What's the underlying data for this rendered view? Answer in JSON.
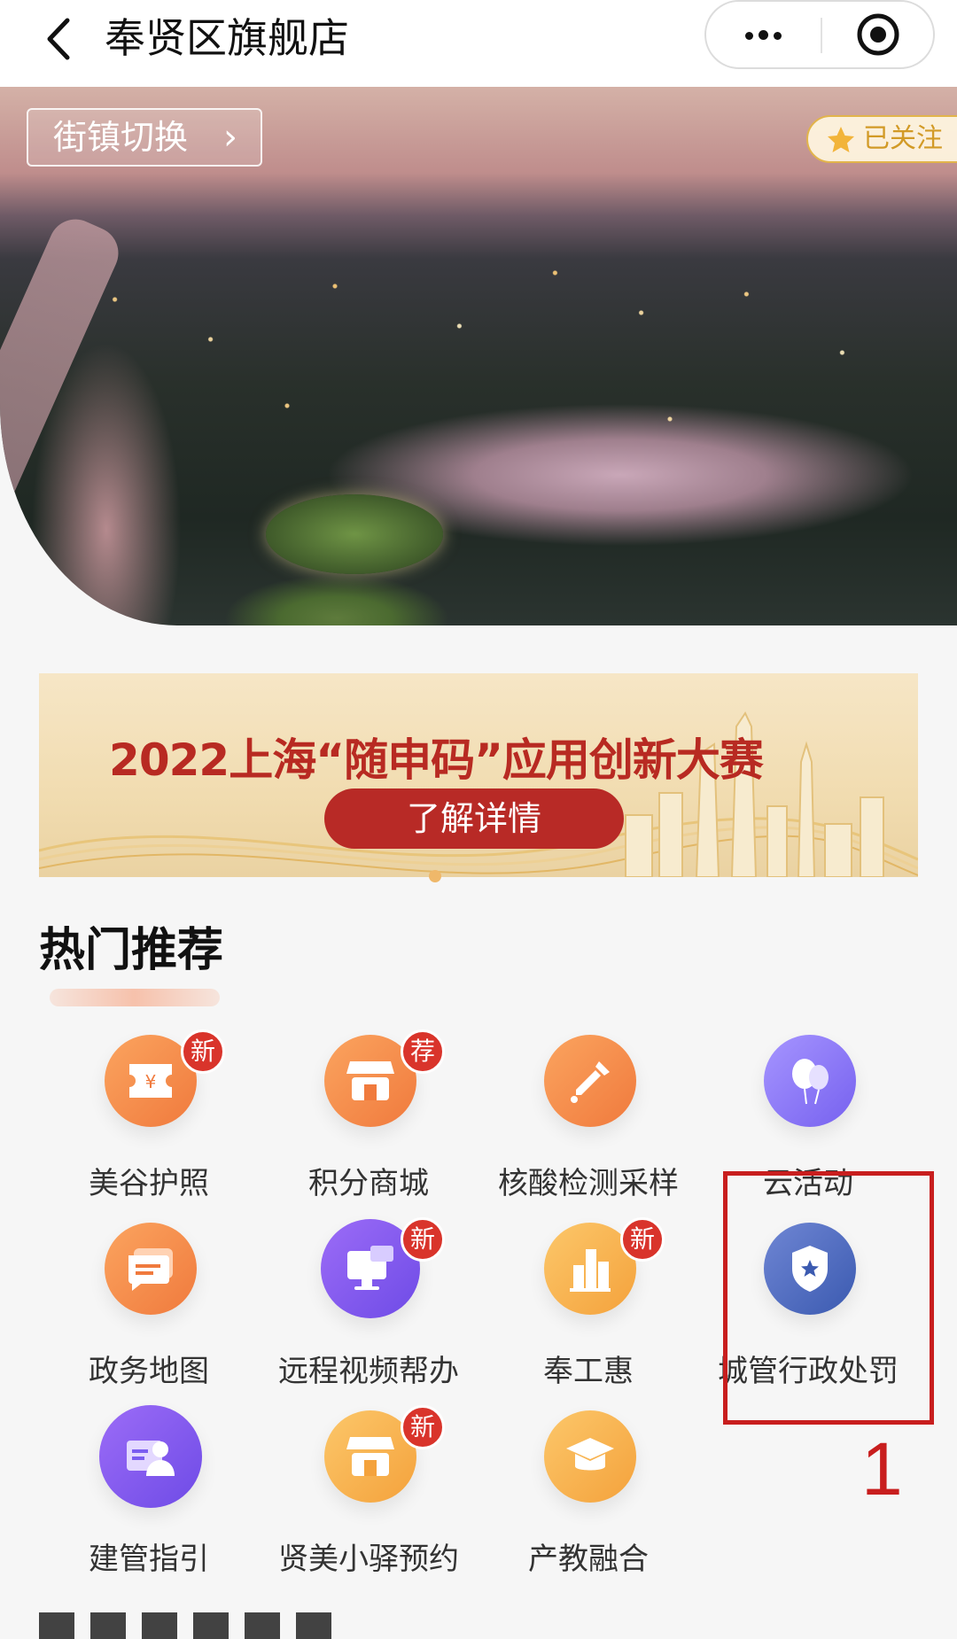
{
  "header": {
    "title": "奉贤区旗舰店"
  },
  "hero": {
    "town_switch_label": "街镇切换",
    "followed_label": "已关注"
  },
  "promo": {
    "title": "2022上海“随申码”应用创新大赛",
    "button_label": "了解详情"
  },
  "hot": {
    "title": "热门推荐",
    "items": [
      {
        "label": "美谷护照",
        "icon": "ticket-icon",
        "badge": "新"
      },
      {
        "label": "积分商城",
        "icon": "shop-icon",
        "badge": "荐"
      },
      {
        "label": "核酸检测采样",
        "icon": "dropper-icon",
        "badge": ""
      },
      {
        "label": "云活动",
        "icon": "balloon-icon",
        "badge": ""
      },
      {
        "label": "政务地图",
        "icon": "message-icon",
        "badge": ""
      },
      {
        "label": "远程视频帮办",
        "icon": "monitor-icon",
        "badge": "新"
      },
      {
        "label": "奉工惠",
        "icon": "building-icon",
        "badge": "新"
      },
      {
        "label": "城管行政处罚",
        "icon": "shield-star-icon",
        "badge": ""
      },
      {
        "label": "建管指引",
        "icon": "user-card-icon",
        "badge": ""
      },
      {
        "label": "贤美小驿预约",
        "icon": "store-icon",
        "badge": "新"
      },
      {
        "label": "产教融合",
        "icon": "graduation-cap-icon",
        "badge": ""
      }
    ]
  },
  "annotation": {
    "number": "1"
  },
  "colors": {
    "accent_red": "#c81e1e",
    "badge_red": "#d9342b",
    "promo_red": "#b82a26"
  }
}
